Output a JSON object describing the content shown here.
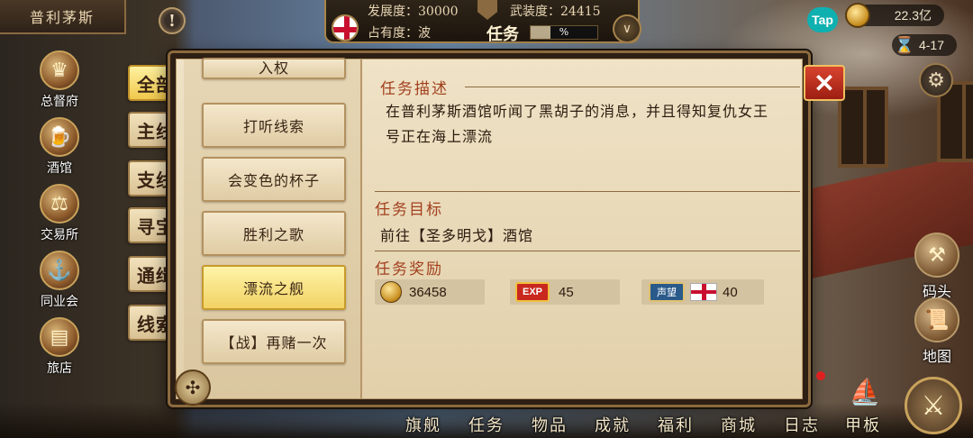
{
  "city": {
    "name": "普利茅斯"
  },
  "status": {
    "development_label": "发展度：30000",
    "military_label": "武装度：24415",
    "occupancy_label": "占有度：波",
    "task_label": "任务",
    "task_progress_text": "%"
  },
  "resources": {
    "tap_label": "Tap",
    "gold_amount": "22.3亿",
    "date": "4-17"
  },
  "left_nav": {
    "items": [
      {
        "label": "总督府",
        "icon": "crown-icon"
      },
      {
        "label": "酒馆",
        "icon": "mug-icon"
      },
      {
        "label": "交易所",
        "icon": "scales-icon"
      },
      {
        "label": "同业会",
        "icon": "anchor-icon"
      },
      {
        "label": "旅店",
        "icon": "bed-icon"
      }
    ]
  },
  "categories": [
    {
      "label": "全部",
      "active": true
    },
    {
      "label": "主线",
      "active": false
    },
    {
      "label": "支线",
      "active": false
    },
    {
      "label": "寻宝",
      "active": false
    },
    {
      "label": "通缉",
      "active": false
    },
    {
      "label": "线索",
      "active": false
    }
  ],
  "quests": {
    "partial_top": "入权",
    "items": [
      {
        "label": "打听线索",
        "active": false
      },
      {
        "label": "会变色的杯子",
        "active": false
      },
      {
        "label": "胜利之歌",
        "active": false
      },
      {
        "label": "漂流之舰",
        "active": true
      },
      {
        "label": "【战】再赌一次",
        "active": false
      }
    ]
  },
  "detail": {
    "desc_title": "任务描述",
    "desc_text": "在普利茅斯酒馆听闻了黑胡子的消息，并且得知复仇女王号正在海上漂流",
    "goal_title": "任务目标",
    "goal_text": "前往【圣多明戈】酒馆",
    "reward_title": "任务奖励",
    "rewards": {
      "gold": "36458",
      "exp_badge": "EXP",
      "exp": "45",
      "rep_badge": "声望",
      "rep": "40"
    }
  },
  "right_nav": {
    "items": [
      {
        "label": "码头",
        "icon": "dock-icon"
      },
      {
        "label": "地图",
        "icon": "map-scroll-icon"
      }
    ]
  },
  "bottom_nav": {
    "items": [
      "旗舰",
      "任务",
      "物品",
      "成就",
      "福利",
      "商城",
      "日志",
      "甲板"
    ]
  },
  "colors": {
    "accent_red": "#a2401e",
    "active_tab": "#f0c84c",
    "england_red": "#c8102e"
  }
}
